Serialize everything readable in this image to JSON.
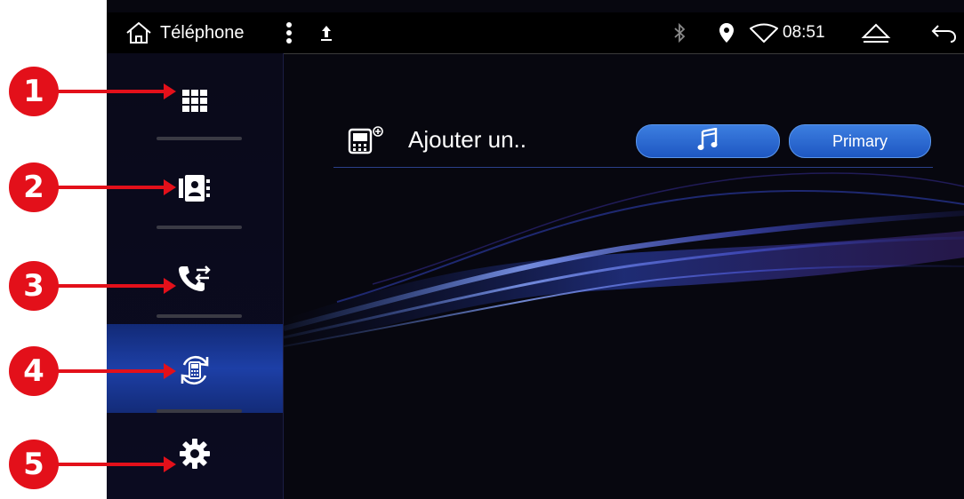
{
  "status_bar": {
    "title": "Téléphone",
    "time": "08:51",
    "icons": [
      "home-icon",
      "more-vert-icon",
      "upload-icon",
      "bluetooth-icon",
      "location-icon",
      "wifi-icon",
      "eject-icon",
      "back-icon"
    ]
  },
  "sidebar": {
    "items": [
      {
        "name": "dialpad",
        "icon": "dialpad-icon",
        "active": false
      },
      {
        "name": "contacts",
        "icon": "contacts-icon",
        "active": false
      },
      {
        "name": "call-log",
        "icon": "call-log-icon",
        "active": false
      },
      {
        "name": "device-sync",
        "icon": "phone-sync-icon",
        "active": true
      },
      {
        "name": "settings",
        "icon": "gear-icon",
        "active": false
      }
    ]
  },
  "device": {
    "name": "Ajouter un..",
    "music_icon": "music-note-icon",
    "primary_label": "Primary"
  },
  "callouts": [
    "1",
    "2",
    "3",
    "4",
    "5"
  ],
  "colors": {
    "callout": "#e3101a",
    "pill": "#2b6ad4",
    "active_nav": "#1d3fa6"
  }
}
